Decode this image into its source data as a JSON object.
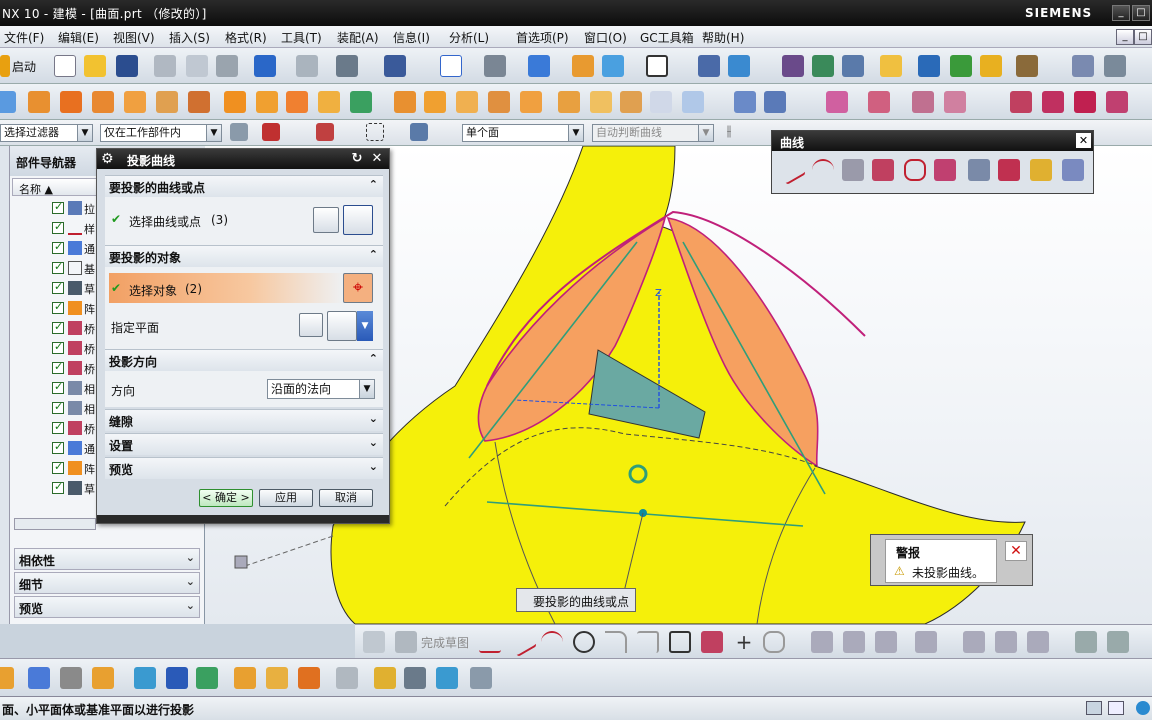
{
  "window": {
    "title": "NX 10 - 建模 - [曲面.prt （修改的）]",
    "brand": "SIEMENS",
    "btn_min": "_",
    "btn_max": "□",
    "btn_close": "✕",
    "btn_min2": "_",
    "btn_max2": "□"
  },
  "menu": {
    "items": [
      "文件(F)",
      "编辑(E)",
      "视图(V)",
      "插入(S)",
      "格式(R)",
      "工具(T)",
      "装配(A)",
      "信息(I)",
      "分析(L)",
      "首选项(P)",
      "窗口(O)",
      "GC工具箱",
      "帮助(H)"
    ]
  },
  "toolbar1": {
    "start_label": "启动"
  },
  "filterbar": {
    "filter": "选择过滤器",
    "scope": "仅在工作部件内",
    "face_rule": "单个面",
    "curve_rule": "自动判断曲线"
  },
  "navigator": {
    "title": "部件导航器",
    "col_name": "名称",
    "rows": [
      "拉",
      "样",
      "通",
      "基",
      "草",
      "阵",
      "桥",
      "桥",
      "桥",
      "相",
      "相",
      "桥",
      "通",
      "阵",
      "草"
    ],
    "sections": [
      "相依性",
      "细节",
      "预览"
    ]
  },
  "dialog": {
    "title": "投影曲线",
    "sec_curves": "要投影的曲线或点",
    "select_curve": "选择曲线或点",
    "select_curve_count": "(3)",
    "sec_objects": "要投影的对象",
    "select_object": "选择对象",
    "select_object_count": "(2)",
    "specify_plane": "指定平面",
    "sec_direction": "投影方向",
    "direction_label": "方向",
    "direction_value": "沿面的法向",
    "sec_gap": "缝隙",
    "sec_settings": "设置",
    "sec_preview": "预览",
    "ok": "< 确定 >",
    "apply": "应用",
    "cancel": "取消"
  },
  "curve_toolbar": {
    "title": "曲线"
  },
  "warning": {
    "title": "警报",
    "message": "未投影曲线。"
  },
  "tooltip": {
    "text": "要投影的曲线或点"
  },
  "bottombar": {
    "finish_sketch": "完成草图"
  },
  "status": {
    "text": "面、小平面体或基准平面以进行投影"
  },
  "colors": {
    "surface_yellow": "#f5f00a",
    "surface_orange": "#f6a060",
    "edge_magenta": "#c0207a",
    "curve_green": "#2f9e7a",
    "plane_teal": "#6aa9a2",
    "axis_blue": "#2050e0"
  }
}
